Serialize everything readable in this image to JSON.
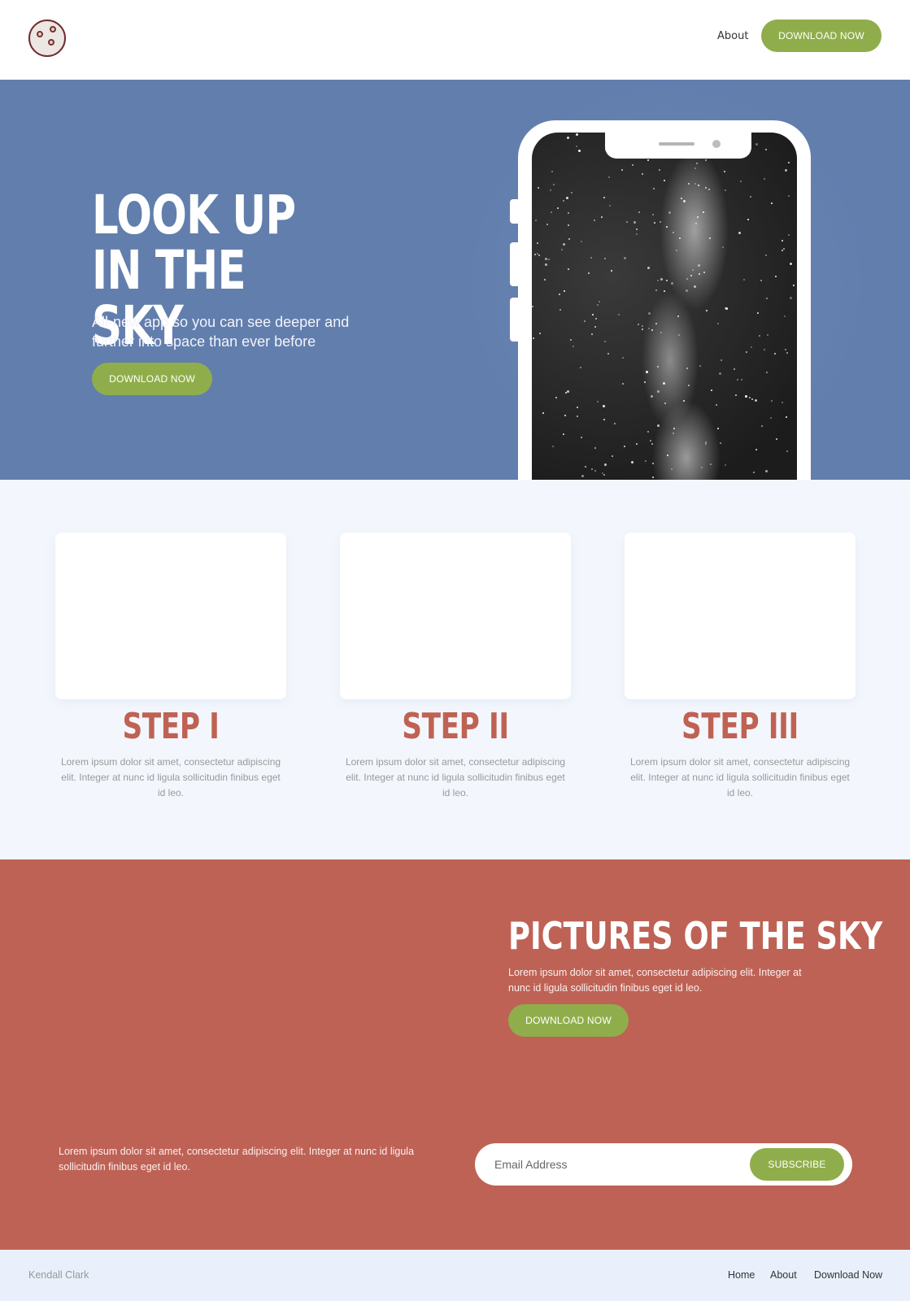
{
  "header": {
    "logo_icon": "moon-logo-icon",
    "nav_about": "About",
    "cta_label": "DOWNLOAD NOW"
  },
  "hero": {
    "title": "LOOK UP IN THE SKY",
    "subtitle": "All-new app so you can see deeper and further into space than ever before",
    "cta_label": "DOWNLOAD NOW"
  },
  "steps": [
    {
      "title": "STEP I",
      "text": "Lorem ipsum dolor sit amet, consectetur adipiscing elit. Integer at nunc id ligula sollicitudin finibus eget id leo."
    },
    {
      "title": "STEP II",
      "text": "Lorem ipsum dolor sit amet, consectetur adipiscing elit. Integer at nunc id ligula sollicitudin finibus eget id leo."
    },
    {
      "title": "STEP III",
      "text": "Lorem ipsum dolor sit amet, consectetur adipiscing elit. Integer at nunc id ligula sollicitudin finibus eget id leo."
    }
  ],
  "pictures": {
    "title": "PICTURES OF THE SKY",
    "text": "Lorem ipsum dolor sit amet, consectetur adipiscing elit. Integer at nunc id ligula sollicitudin finibus eget id leo.",
    "cta_label": "DOWNLOAD NOW"
  },
  "newsletter": {
    "text": "Lorem ipsum dolor sit amet, consectetur adipiscing elit. Integer at nunc id ligula sollicitudin finibus eget id leo.",
    "email_placeholder": "Email Address",
    "email_value": "",
    "subscribe_label": "SUBSCRIBE"
  },
  "footer": {
    "name": "Kendall Clark",
    "links": [
      "Home",
      "About",
      "Download Now"
    ]
  },
  "colors": {
    "accent_green": "#8fae4b",
    "hero_blue": "#627ead",
    "brick_red": "#be6255",
    "light_bg": "#f3f7fd",
    "footer_bg": "#e9f0fb"
  }
}
